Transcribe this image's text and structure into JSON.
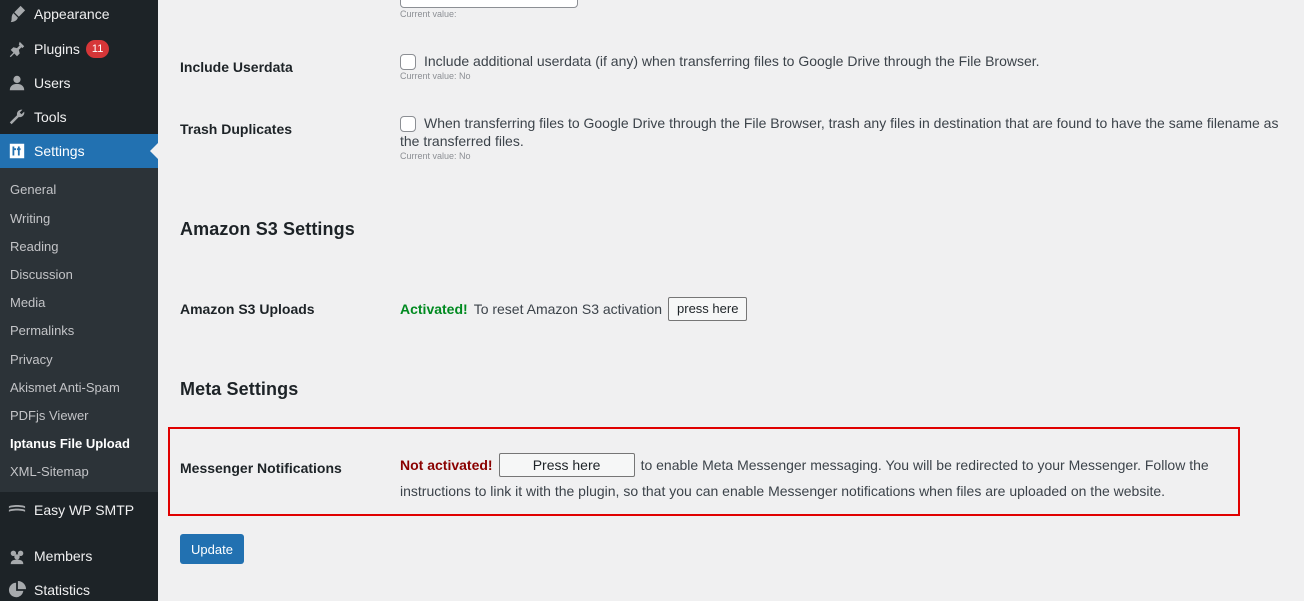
{
  "sidebar": {
    "menu": [
      {
        "label": "Appearance",
        "icon": "paintbrush-icon"
      },
      {
        "label": "Plugins",
        "icon": "plugin-icon",
        "badge": "11"
      },
      {
        "label": "Users",
        "icon": "user-icon"
      },
      {
        "label": "Tools",
        "icon": "wrench-icon"
      },
      {
        "label": "Settings",
        "icon": "settings-icon"
      }
    ],
    "submenu": [
      "General",
      "Writing",
      "Reading",
      "Discussion",
      "Media",
      "Permalinks",
      "Privacy",
      "Akismet Anti-Spam",
      "PDFjs Viewer",
      "Iptanus File Upload",
      "XML-Sitemap"
    ],
    "menu_after": [
      {
        "label": "Easy WP SMTP",
        "icon": "mail-icon"
      },
      {
        "label": "Members",
        "icon": "members-icon"
      },
      {
        "label": "Statistics",
        "icon": "pie-chart-icon"
      }
    ]
  },
  "settings": {
    "current_value_label": "Current value:",
    "include_userdata": {
      "label": "Include Userdata",
      "description": "Include additional userdata (if any) when transferring files to Google Drive through the File Browser.",
      "current": "Current value: No"
    },
    "trash_duplicates": {
      "label": "Trash Duplicates",
      "description_line1": "When transferring files to Google Drive through the File Browser, trash any files in destination that are found to have the same filename as",
      "description_line2": "the transferred files.",
      "current": "Current value: No"
    },
    "amazon_heading": "Amazon S3 Settings",
    "amazon_uploads": {
      "label": "Amazon S3 Uploads",
      "status": "Activated!",
      "text": "To reset Amazon S3 activation",
      "button": "press here"
    },
    "meta_heading": "Meta Settings",
    "messenger": {
      "label": "Messenger Notifications",
      "status": "Not activated!",
      "button": "Press here",
      "text_line1": "to enable Meta Messenger messaging. You will be redirected to your Messenger. Follow the",
      "text_line2": "instructions to link it with the plugin, so that you can enable Messenger notifications when files are uploaded on the website."
    },
    "update_button": "Update"
  },
  "colors": {
    "sidebar_bg": "#1d2327",
    "submenu_bg": "#2c3338",
    "accent": "#2271b1",
    "activated": "#008a20",
    "not_activated": "#8a0000",
    "highlight": "#e00000"
  }
}
